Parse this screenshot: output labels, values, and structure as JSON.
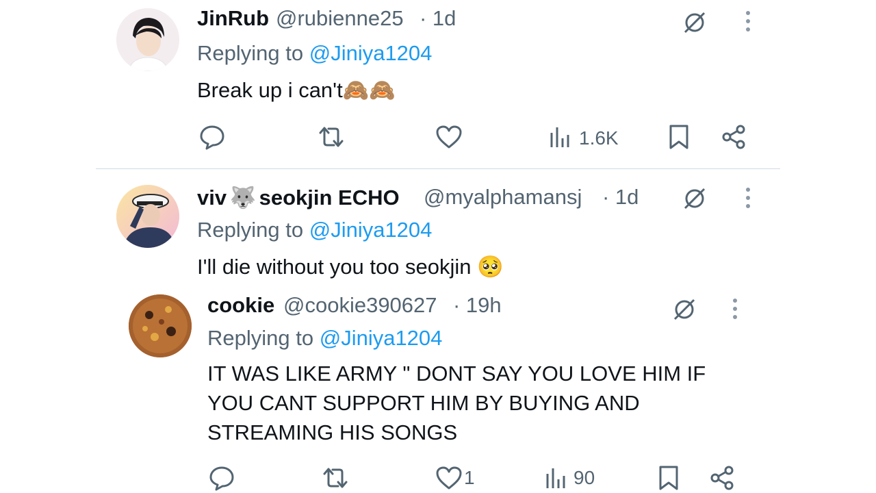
{
  "tweets": [
    {
      "display_name": "JinRub",
      "handle": "@rubienne25",
      "time": "· 1d",
      "replying_prefix": "Replying to",
      "replying_to": "@Jiniya1204",
      "text": "Break up i can't🙈🙈",
      "views": "1.6K",
      "likes": ""
    },
    {
      "display_name_part1": "viv",
      "display_name_emoji": "🐺",
      "display_name_part2": "seokjin ECHO",
      "handle": "@myalphamansj",
      "time": "· 1d",
      "replying_prefix": "Replying to",
      "replying_to": "@Jiniya1204",
      "text": "I'll die without you too seokjin 🥺"
    },
    {
      "display_name": "cookie",
      "handle": "@cookie390627",
      "time": "· 19h",
      "replying_prefix": "Replying to",
      "replying_to": "@Jiniya1204",
      "text": "IT WAS LIKE ARMY \" DONT SAY YOU LOVE HIM IF YOU CANT SUPPORT HIM BY BUYING AND STREAMING HIS SONGS",
      "likes": "1",
      "views": "90"
    }
  ],
  "colors": {
    "text": "#0f1419",
    "secondary": "#536471",
    "mention": "#1d9bf0",
    "divider": "#cfd9de"
  },
  "icons": [
    "grok-icon",
    "more-icon",
    "reply-icon",
    "retweet-icon",
    "like-icon",
    "views-icon",
    "bookmark-icon",
    "share-icon"
  ]
}
